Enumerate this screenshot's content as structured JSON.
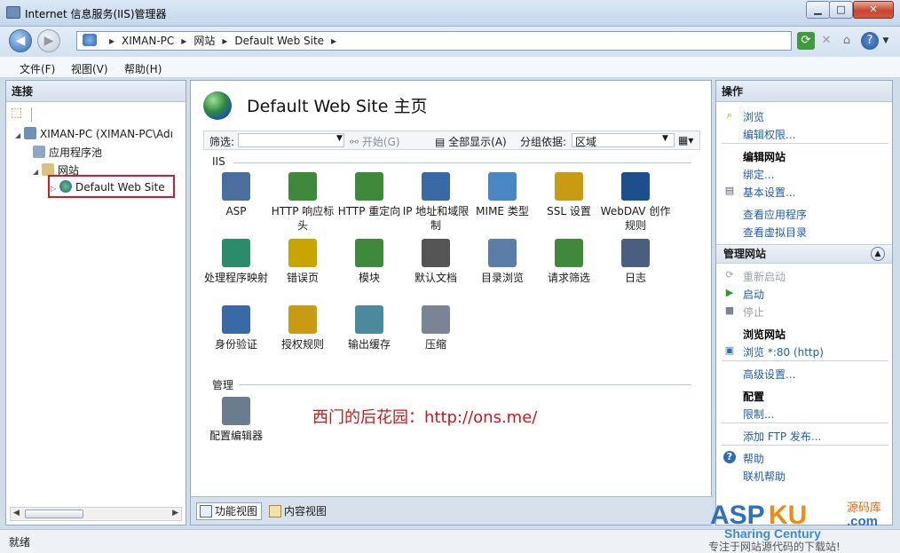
{
  "window": {
    "title": "Internet 信息服务(IIS)管理器"
  },
  "address": {
    "segments": [
      "XIMAN-PC",
      "网站",
      "Default Web Site"
    ]
  },
  "menu": [
    "文件(F)",
    "视图(V)",
    "帮助(H)"
  ],
  "connections": {
    "header": "连接",
    "tree": {
      "root": "XIMAN-PC (XIMAN-PC\\Adı",
      "app_pools": "应用程序池",
      "sites": "网站",
      "site": "Default Web Site"
    }
  },
  "center": {
    "title": "Default Web Site 主页",
    "filter": {
      "label": "筛选:",
      "start": "开始(G)",
      "show_all": "全部显示(A)",
      "group_by": "分组依据:",
      "group_value": "区域"
    },
    "groups": {
      "iis": "IIS",
      "manage": "管理"
    },
    "features_iis": [
      {
        "label": "ASP",
        "icon": "asp-icon",
        "color": "#4a6f9c"
      },
      {
        "label": "HTTP 响应标头",
        "icon": "http-response-headers-icon",
        "color": "#3f8a3a"
      },
      {
        "label": "HTTP 重定向",
        "icon": "http-redirect-icon",
        "color": "#3f8a3a"
      },
      {
        "label": "IP 地址和域限制",
        "icon": "ip-restrictions-icon",
        "color": "#3a6aa6"
      },
      {
        "label": "MIME 类型",
        "icon": "mime-types-icon",
        "color": "#4a86c4"
      },
      {
        "label": "SSL 设置",
        "icon": "ssl-lock-icon",
        "color": "#c99b12"
      },
      {
        "label": "WebDAV 创作规则",
        "icon": "webdav-icon",
        "color": "#1d4f8f"
      },
      {
        "label": "处理程序映射",
        "icon": "handler-mappings-icon",
        "color": "#2c8c6a"
      },
      {
        "label": "错误页",
        "icon": "error-pages-icon",
        "color": "#c9a500"
      },
      {
        "label": "模块",
        "icon": "modules-icon",
        "color": "#3f8a3a"
      },
      {
        "label": "默认文档",
        "icon": "default-document-icon",
        "color": "#555555"
      },
      {
        "label": "目录浏览",
        "icon": "directory-browsing-icon",
        "color": "#5a7ea8"
      },
      {
        "label": "请求筛选",
        "icon": "request-filtering-icon",
        "color": "#3f8a3a"
      },
      {
        "label": "日志",
        "icon": "logging-icon",
        "color": "#4a5f80"
      },
      {
        "label": "身份验证",
        "icon": "authentication-icon",
        "color": "#3a6aa6"
      },
      {
        "label": "授权规则",
        "icon": "authorization-rules-icon",
        "color": "#c99b12"
      },
      {
        "label": "输出缓存",
        "icon": "output-caching-icon",
        "color": "#4a8a9c"
      },
      {
        "label": "压缩",
        "icon": "compression-icon",
        "color": "#7a8494"
      }
    ],
    "features_manage": [
      {
        "label": "配置编辑器",
        "icon": "configuration-editor-icon",
        "color": "#6b7b90"
      }
    ],
    "watermark": "西门的后花园：http://ons.me/",
    "view_tabs": [
      "功能视图",
      "内容视图"
    ]
  },
  "actions": {
    "header": "操作",
    "explore": "浏览",
    "edit_permissions": "编辑权限...",
    "edit_site_header": "编辑网站",
    "bindings": "绑定...",
    "basic_settings": "基本设置...",
    "view_applications": "查看应用程序",
    "view_virtual_dirs": "查看虚拟目录",
    "manage_site_header": "管理网站",
    "restart": "重新启动",
    "start": "启动",
    "stop": "停止",
    "browse_site_header": "浏览网站",
    "browse_80": "浏览 *:80 (http)",
    "advanced_settings": "高级设置...",
    "config_header": "配置",
    "limits": "限制...",
    "add_ftp": "添加 FTP 发布...",
    "help": "帮助",
    "online_help": "联机帮助"
  },
  "status": {
    "text": "就绪"
  },
  "logo": {
    "brand_a": "ASP",
    "brand_b": "KU",
    "com": ".com",
    "cn": "源码库",
    "sub": "Sharing Century",
    "slogan": "专注于网站源代码的下载站!"
  }
}
